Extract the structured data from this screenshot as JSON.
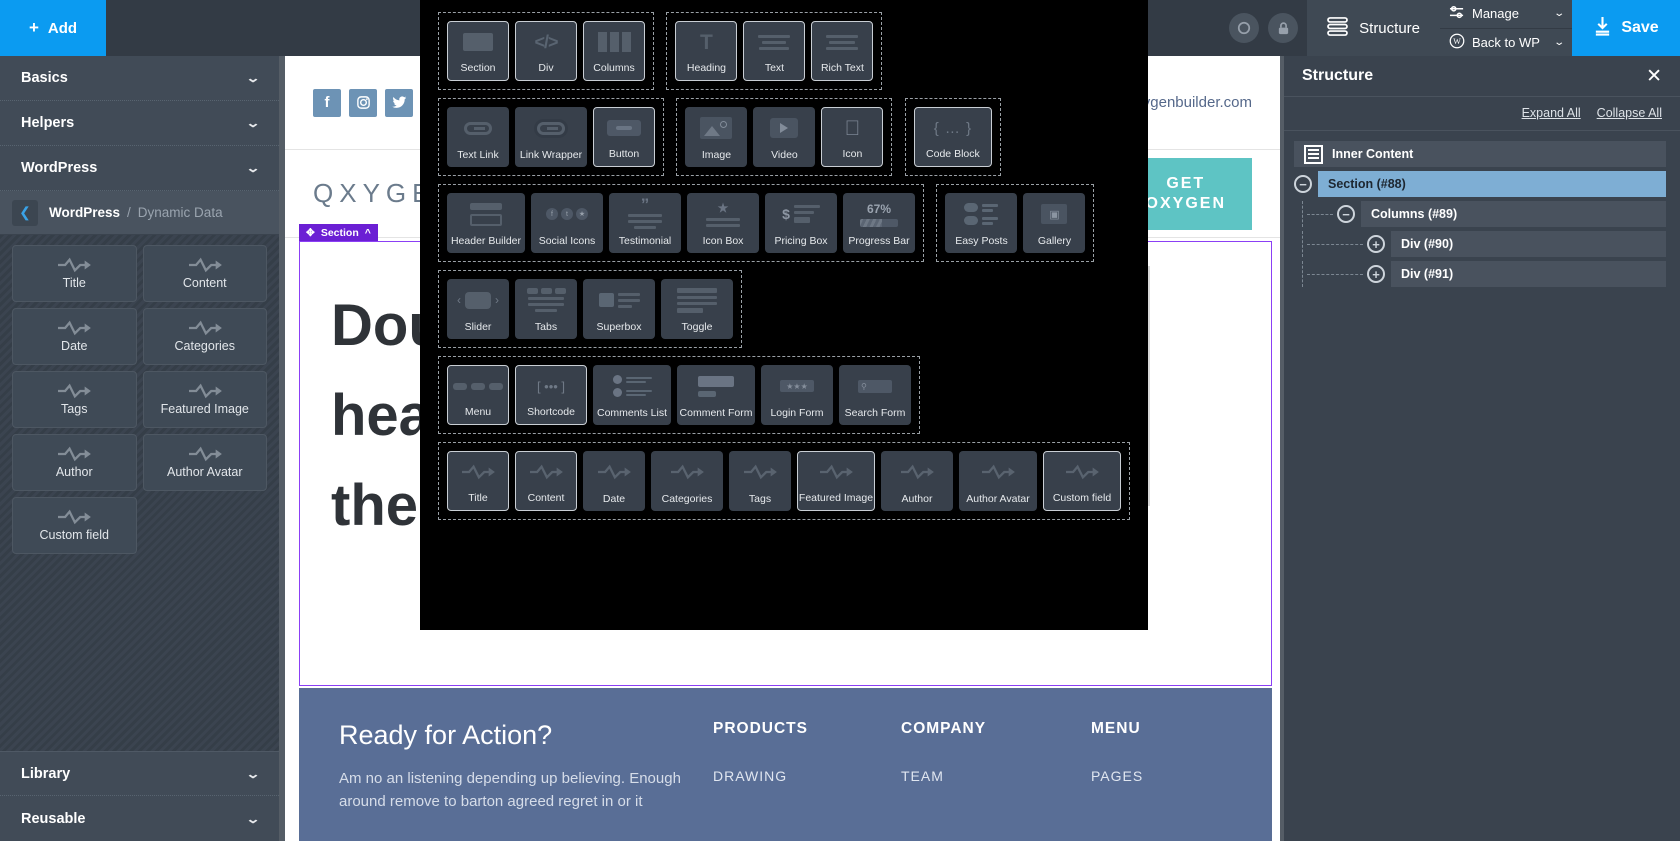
{
  "sidebar": {
    "add_button": "Add",
    "add_icon": "plus-icon",
    "accordions": [
      {
        "label": "Basics",
        "icon": "chevron-down-icon"
      },
      {
        "label": "Helpers",
        "icon": "chevron-down-icon"
      },
      {
        "label": "WordPress",
        "icon": "chevron-down-icon"
      }
    ],
    "breadcrumb": {
      "back_icon": "chevron-left-icon",
      "root": "WordPress",
      "separator": "/",
      "current": "Dynamic Data"
    },
    "dynamic_data_tiles": [
      {
        "label": "Title",
        "icon": "dynamic-data-icon"
      },
      {
        "label": "Content",
        "icon": "dynamic-data-icon"
      },
      {
        "label": "Date",
        "icon": "dynamic-data-icon"
      },
      {
        "label": "Categories",
        "icon": "dynamic-data-icon"
      },
      {
        "label": "Tags",
        "icon": "dynamic-data-icon"
      },
      {
        "label": "Featured Image",
        "icon": "dynamic-data-icon"
      },
      {
        "label": "Author",
        "icon": "dynamic-data-icon"
      },
      {
        "label": "Author Avatar",
        "icon": "dynamic-data-icon"
      },
      {
        "label": "Custom field",
        "icon": "dynamic-data-icon"
      }
    ],
    "bottom_accordions": [
      {
        "label": "Library",
        "icon": "chevron-down-icon"
      },
      {
        "label": "Reusable",
        "icon": "chevron-down-icon"
      }
    ]
  },
  "topbar": {
    "lock_icon": "lock-icon",
    "circle_icon": "circle-icon",
    "structure_label": "Structure",
    "structure_icon": "structure-icon",
    "manage_label": "Manage",
    "manage_icon": "sliders-icon",
    "manage_caret": "chevron-down-icon",
    "back_to_wp_label": "Back to WP",
    "back_to_wp_icon": "wordpress-icon",
    "back_to_wp_caret": "chevron-down-icon",
    "save_label": "Save",
    "save_icon": "download-icon"
  },
  "structure_panel": {
    "title": "Structure",
    "close_icon": "close-icon",
    "expand_all": "Expand All",
    "collapse_all": "Collapse All",
    "tree": [
      {
        "label": "Inner Content",
        "depth": 0,
        "toggle": "none",
        "icon": "document-icon",
        "selected": false
      },
      {
        "label": "Section (#88)",
        "depth": 0,
        "toggle": "minus",
        "selected": true
      },
      {
        "label": "Columns (#89)",
        "depth": 1,
        "toggle": "minus",
        "selected": false
      },
      {
        "label": "Div (#90)",
        "depth": 2,
        "toggle": "plus",
        "selected": false
      },
      {
        "label": "Div (#91)",
        "depth": 2,
        "toggle": "plus",
        "selected": false
      }
    ]
  },
  "page_preview": {
    "social": [
      {
        "name": "facebook-icon",
        "glyph": "f"
      },
      {
        "name": "instagram-icon",
        "glyph": "□"
      },
      {
        "name": "twitter-icon",
        "glyph": "ᴠ"
      }
    ],
    "email": "oxygenbuilder.com",
    "brand": "QXYGEN",
    "cta_line1": "GET",
    "cta_line2": "OXYGEN",
    "section_tag": "Section",
    "section_tag_icon": "move-icon",
    "section_tag_caret": "chevron-up-icon",
    "hero_heading": "Dou\nhea\nthe",
    "footer": {
      "heading": "Ready for Action?",
      "body": "Am no an listening depending up believing. Enough around remove to barton agreed regret in or it",
      "columns": [
        {
          "heading": "PRODUCTS",
          "items": [
            "DRAWING"
          ]
        },
        {
          "heading": "COMPANY",
          "items": [
            "TEAM"
          ]
        },
        {
          "heading": "MENU",
          "items": [
            "PAGES"
          ]
        }
      ]
    }
  },
  "elements_modal": {
    "groups": [
      {
        "row": 1,
        "items": [
          {
            "label": "Section",
            "icon": "section-icon",
            "highlight": true
          },
          {
            "label": "Div",
            "icon": "code-icon",
            "highlight": true
          },
          {
            "label": "Columns",
            "icon": "columns-icon",
            "highlight": true
          }
        ]
      },
      {
        "row": 1,
        "items": [
          {
            "label": "Heading",
            "icon": "heading-icon",
            "highlight": true
          },
          {
            "label": "Text",
            "icon": "text-icon",
            "highlight": true
          },
          {
            "label": "Rich Text",
            "icon": "rich-text-icon",
            "highlight": true
          }
        ]
      },
      {
        "row": 2,
        "items": [
          {
            "label": "Text Link",
            "icon": "link-icon",
            "highlight": false
          },
          {
            "label": "Link Wrapper",
            "icon": "link-wrapper-icon",
            "highlight": false
          },
          {
            "label": "Button",
            "icon": "button-icon",
            "highlight": true
          }
        ]
      },
      {
        "row": 2,
        "items": [
          {
            "label": "Image",
            "icon": "image-icon",
            "highlight": false
          },
          {
            "label": "Video",
            "icon": "video-icon",
            "highlight": false
          },
          {
            "label": "Icon",
            "icon": "apple-icon",
            "highlight": true
          }
        ]
      },
      {
        "row": 2,
        "items": [
          {
            "label": "Code Block",
            "icon": "code-block-icon",
            "highlight": true
          }
        ]
      },
      {
        "row": 3,
        "items": [
          {
            "label": "Header Builder",
            "icon": "header-builder-icon",
            "highlight": false
          },
          {
            "label": "Social Icons",
            "icon": "social-icons-icon",
            "highlight": false
          },
          {
            "label": "Testimonial",
            "icon": "testimonial-icon",
            "highlight": false
          },
          {
            "label": "Icon Box",
            "icon": "icon-box-icon",
            "highlight": false
          },
          {
            "label": "Pricing Box",
            "icon": "pricing-box-icon",
            "highlight": false
          },
          {
            "label": "Progress Bar",
            "icon": "progress-bar-icon",
            "highlight": false,
            "value": "67%"
          }
        ]
      },
      {
        "row": 3,
        "items": [
          {
            "label": "Easy Posts",
            "icon": "easy-posts-icon",
            "highlight": true
          },
          {
            "label": "Gallery",
            "icon": "gallery-icon",
            "highlight": false
          }
        ]
      },
      {
        "row": 4,
        "items": [
          {
            "label": "Slider",
            "icon": "slider-icon",
            "highlight": false
          },
          {
            "label": "Tabs",
            "icon": "tabs-icon",
            "highlight": false
          },
          {
            "label": "Superbox",
            "icon": "superbox-icon",
            "highlight": false
          },
          {
            "label": "Toggle",
            "icon": "toggle-icon",
            "highlight": false
          }
        ]
      },
      {
        "row": 5,
        "items": [
          {
            "label": "Menu",
            "icon": "menu-icon",
            "highlight": true
          },
          {
            "label": "Shortcode",
            "icon": "shortcode-icon",
            "highlight": true
          },
          {
            "label": "Comments List",
            "icon": "comments-list-icon",
            "highlight": false
          },
          {
            "label": "Comment Form",
            "icon": "comment-form-icon",
            "highlight": false
          },
          {
            "label": "Login Form",
            "icon": "login-form-icon",
            "highlight": false
          },
          {
            "label": "Search Form",
            "icon": "search-form-icon",
            "highlight": false
          }
        ]
      },
      {
        "row": 6,
        "items": [
          {
            "label": "Title",
            "icon": "dynamic-data-icon",
            "highlight": true
          },
          {
            "label": "Content",
            "icon": "dynamic-data-icon",
            "highlight": true
          },
          {
            "label": "Date",
            "icon": "dynamic-data-icon",
            "highlight": false
          },
          {
            "label": "Categories",
            "icon": "dynamic-data-icon",
            "highlight": false
          },
          {
            "label": "Tags",
            "icon": "dynamic-data-icon",
            "highlight": false
          },
          {
            "label": "Featured Image",
            "icon": "dynamic-data-icon",
            "highlight": true
          },
          {
            "label": "Author",
            "icon": "dynamic-data-icon",
            "highlight": false
          },
          {
            "label": "Author Avatar",
            "icon": "dynamic-data-icon",
            "highlight": false
          },
          {
            "label": "Custom field",
            "icon": "dynamic-data-icon",
            "highlight": true
          }
        ]
      }
    ]
  },
  "colors": {
    "accent_blue": "#0b9bf1",
    "sidebar_bg": "#414b57",
    "panel_bg": "#3a434e",
    "modal_bg": "#000000",
    "selection_blue": "#7eaed4",
    "section_purple": "#6b1fd4",
    "cta_teal": "#5ec4c4",
    "footer_blue": "#596e96"
  }
}
